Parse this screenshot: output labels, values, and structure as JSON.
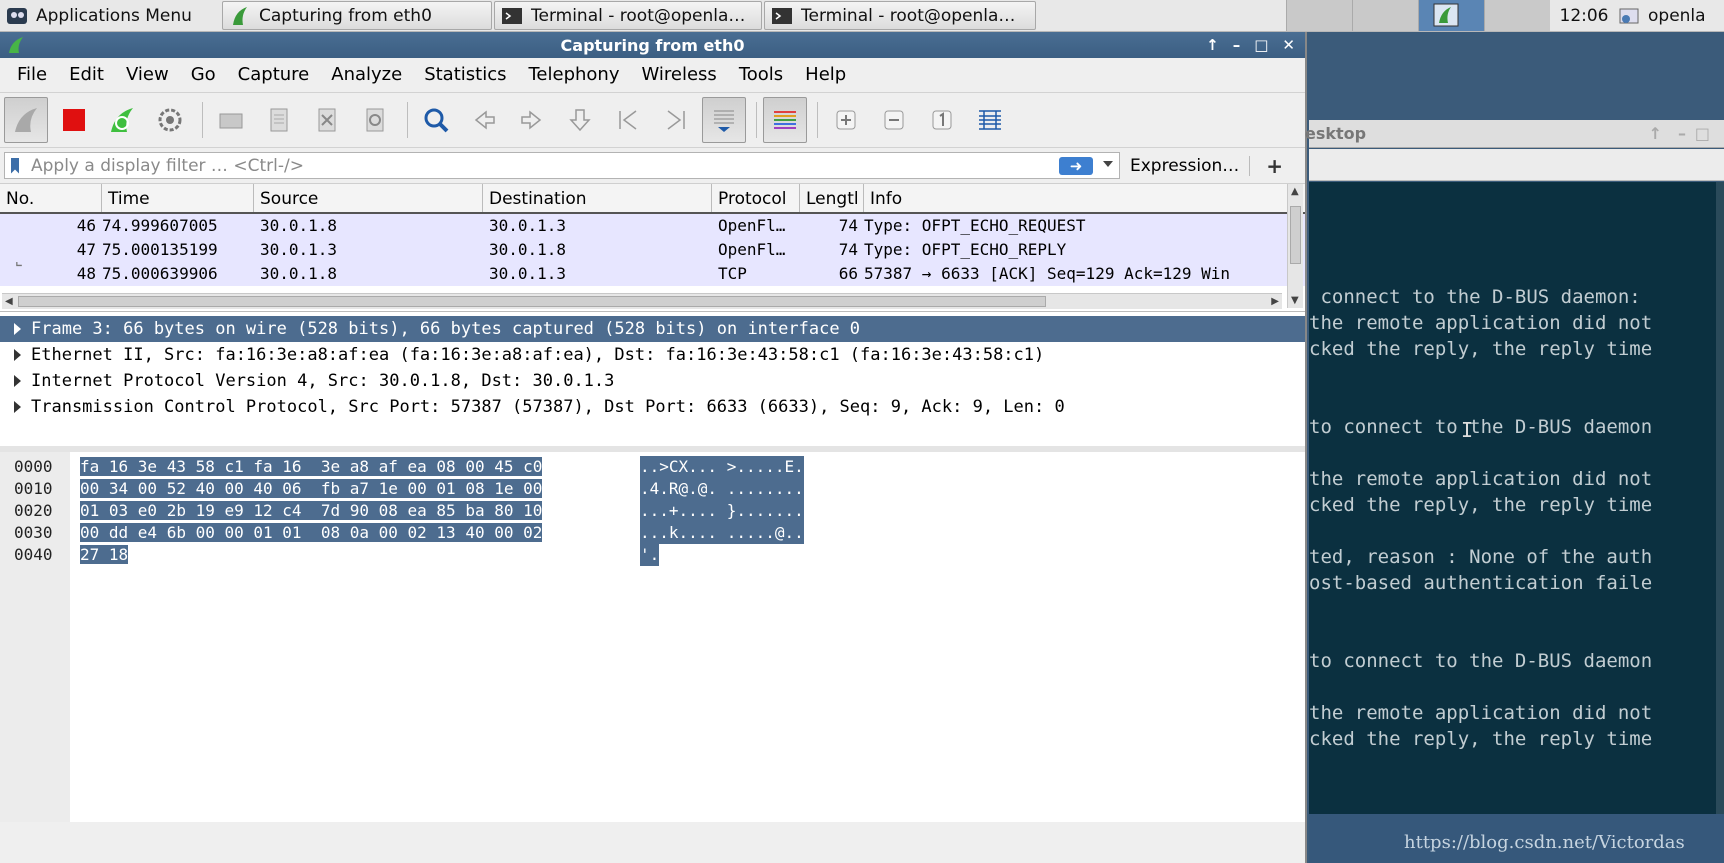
{
  "taskbar": {
    "apps_menu": "Applications Menu",
    "tasks": [
      "Capturing from eth0",
      "Terminal - root@openla…",
      "Terminal - root@openla…"
    ],
    "clock": "12:06",
    "user": "openla"
  },
  "window": {
    "title": "Capturing from eth0"
  },
  "menubar": [
    "File",
    "Edit",
    "View",
    "Go",
    "Capture",
    "Analyze",
    "Statistics",
    "Telephony",
    "Wireless",
    "Tools",
    "Help"
  ],
  "filter": {
    "placeholder": "Apply a display filter … <Ctrl-/>",
    "expression_label": "Expression…",
    "plus_label": "+"
  },
  "packet_list": {
    "columns": [
      "No.",
      "Time",
      "Source",
      "Destination",
      "Protocol",
      "Lengtl",
      "Info"
    ],
    "rows": [
      {
        "no": "46",
        "time": "74.999607005",
        "source": "30.0.1.8",
        "destination": "30.0.1.3",
        "protocol": "OpenFl…",
        "length": "74",
        "info": "Type: OFPT_ECHO_REQUEST"
      },
      {
        "no": "47",
        "time": "75.000135199",
        "source": "30.0.1.3",
        "destination": "30.0.1.8",
        "protocol": "OpenFl…",
        "length": "74",
        "info": "Type: OFPT_ECHO_REPLY"
      },
      {
        "no": "48",
        "time": "75.000639906",
        "source": "30.0.1.8",
        "destination": "30.0.1.3",
        "protocol": "TCP",
        "length": "66",
        "info": "57387 → 6633 [ACK] Seq=129 Ack=129 Win"
      }
    ]
  },
  "details": [
    "Frame 3: 66 bytes on wire (528 bits), 66 bytes captured (528 bits) on interface 0",
    "Ethernet II, Src: fa:16:3e:a8:af:ea (fa:16:3e:a8:af:ea), Dst: fa:16:3e:43:58:c1 (fa:16:3e:43:58:c1)",
    "Internet Protocol Version 4, Src: 30.0.1.8, Dst: 30.0.1.3",
    "Transmission Control Protocol, Src Port: 57387 (57387), Dst Port: 6633 (6633), Seq: 9, Ack: 9, Len: 0"
  ],
  "bytes": [
    {
      "offset": "0000",
      "hex": "fa 16 3e 43 58 c1 fa 16  3e a8 af ea 08 00 45 c0",
      "ascii": "..>CX... >.....E."
    },
    {
      "offset": "0010",
      "hex": "00 34 00 52 40 00 40 06  fb a7 1e 00 01 08 1e 00",
      "ascii": ".4.R@.@. ........"
    },
    {
      "offset": "0020",
      "hex": "01 03 e0 2b 19 e9 12 c4  7d 90 08 ea 85 ba 80 10",
      "ascii": "...+.... }......."
    },
    {
      "offset": "0030",
      "hex": "00 dd e4 6b 00 00 01 01  08 0a 00 02 13 40 00 02",
      "ascii": "...k.... .....@.."
    },
    {
      "offset": "0040",
      "hex": "27 18",
      "ascii": "'."
    }
  ],
  "terminal": {
    "title": "esktop",
    "lines": [
      " connect to the D-BUS daemon:",
      "the remote application did not",
      "cked the reply, the reply time",
      "to connect to the D-BUS daemon",
      "the remote application did not",
      "cked the reply, the reply time",
      "ted, reason : None of the auth",
      "ost-based authentication faile",
      "to connect to the D-BUS daemon",
      "the remote application did not",
      "cked the reply, the reply time"
    ]
  },
  "watermark": "https://blog.csdn.net/Victordas"
}
